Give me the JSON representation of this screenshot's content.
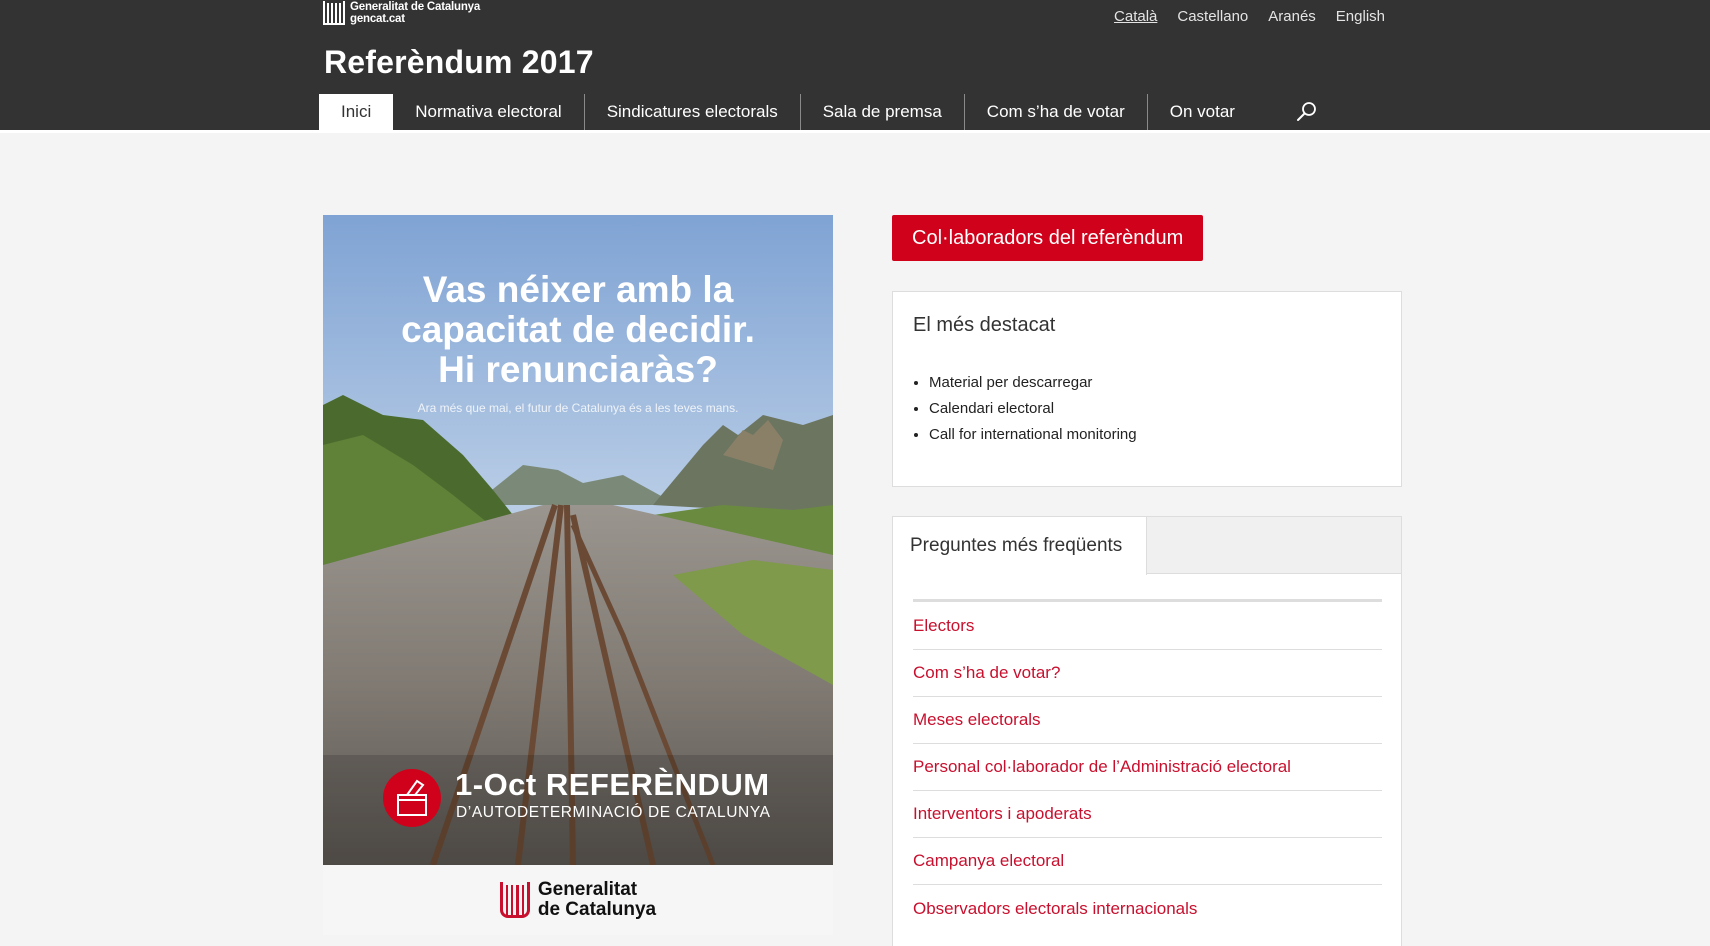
{
  "header": {
    "gov_logo": {
      "line1": "Generalitat de Catalunya",
      "line2": "gencat.cat"
    },
    "languages": [
      {
        "label": "Català",
        "active": true
      },
      {
        "label": "Castellano",
        "active": false
      },
      {
        "label": "Aranés",
        "active": false
      },
      {
        "label": "English",
        "active": false
      }
    ],
    "site_title": "Referèndum 2017",
    "nav": [
      {
        "label": "Inici",
        "active": true
      },
      {
        "label": "Normativa electoral"
      },
      {
        "label": "Sindicatures electorals"
      },
      {
        "label": "Sala de premsa"
      },
      {
        "label": "Com s’ha de votar"
      },
      {
        "label": "On votar"
      }
    ],
    "search_icon": "search-icon"
  },
  "poster": {
    "headline_lines": [
      "Vas néixer amb la",
      "capacitat de decidir.",
      "Hi renunciaràs?"
    ],
    "subtitle": "Ara més que mai, el futur de Catalunya és a les teves mans.",
    "ref_title": "1-Oct REFERÈNDUM",
    "ref_subtitle": "D’AUTODETERMINACIÓ DE CATALUNYA",
    "footer_brand_line1": "Generalitat",
    "footer_brand_line2": "de Catalunya",
    "badge_icon": "ballot-box-icon"
  },
  "sidebar": {
    "collab_button": "Col·laboradors del referèndum",
    "featured": {
      "title": "El més destacat",
      "items": [
        "Material per descarregar",
        "Calendari electoral",
        "Call for international monitoring"
      ]
    },
    "faq": {
      "tab_label": "Preguntes més freqüents",
      "items": [
        "Electors",
        "Com s’ha de votar?",
        "Meses electorals",
        "Personal col·laborador de l’Administració electoral",
        "Interventors i apoderats",
        "Campanya electoral",
        "Observadors electorals internacionals"
      ]
    }
  },
  "colors": {
    "header_bg": "#333333",
    "accent_red": "#d0021b",
    "page_bg": "#f4f4f4"
  }
}
